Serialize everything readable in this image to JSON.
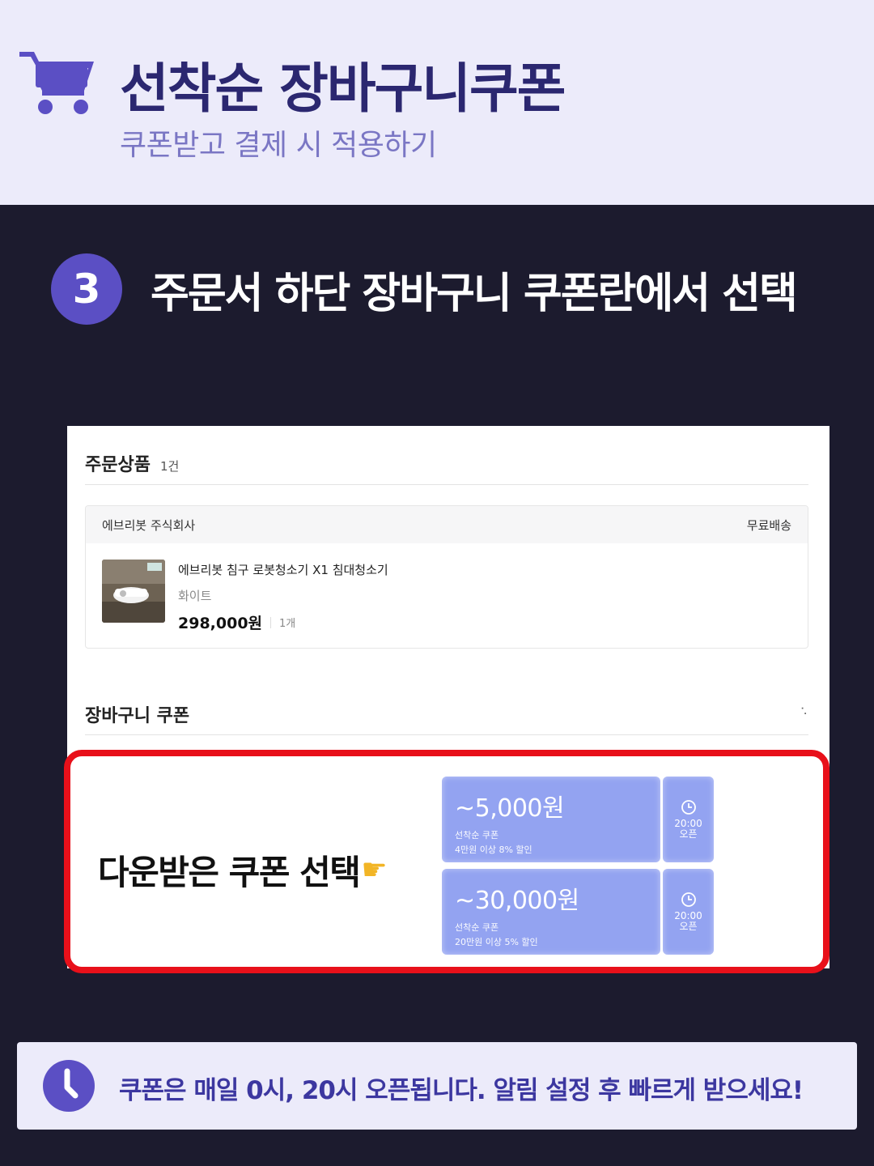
{
  "header": {
    "title": "선착순 장바구니쿠폰",
    "subtitle": "쿠폰받고 결제 시 적용하기",
    "icon": "shopping-cart-icon"
  },
  "step": {
    "number": "3",
    "title": "주문서 하단 장바구니 쿠폰란에서 선택"
  },
  "order": {
    "section_title": "주문상품",
    "item_count": "1건",
    "seller": "에브리봇 주식회사",
    "shipping": "무료배송",
    "product_name": "에브리봇 침구 로봇청소기 X1 침대청소기",
    "option": "화이트",
    "price": "298,000원",
    "quantity": "1개"
  },
  "cart_coupon": {
    "title": "장바구니 쿠폰",
    "highlight_label": "다운받은 쿠폰 선택",
    "coupons": [
      {
        "amount": "~5,000원",
        "type": "선착순 쿠폰",
        "condition": "4만원 이상 8% 할인",
        "time": "20:00",
        "status": "오픈"
      },
      {
        "amount": "~30,000원",
        "type": "선착순 쿠폰",
        "condition": "20만원 이상 5% 할인",
        "time": "20:00",
        "status": "오픈"
      }
    ]
  },
  "note": {
    "text": "쿠폰은 매일 0시, 20시 오픈됩니다. 알림 설정 후 빠르게 받으세요!",
    "icon": "clock-icon"
  },
  "colors": {
    "header_bg": "#ecebfa",
    "title": "#2b2770",
    "accent": "#5b4fc4",
    "dark_bg": "#1c1b2e",
    "highlight_border": "#e8101a",
    "coupon": "#93a3f1"
  }
}
